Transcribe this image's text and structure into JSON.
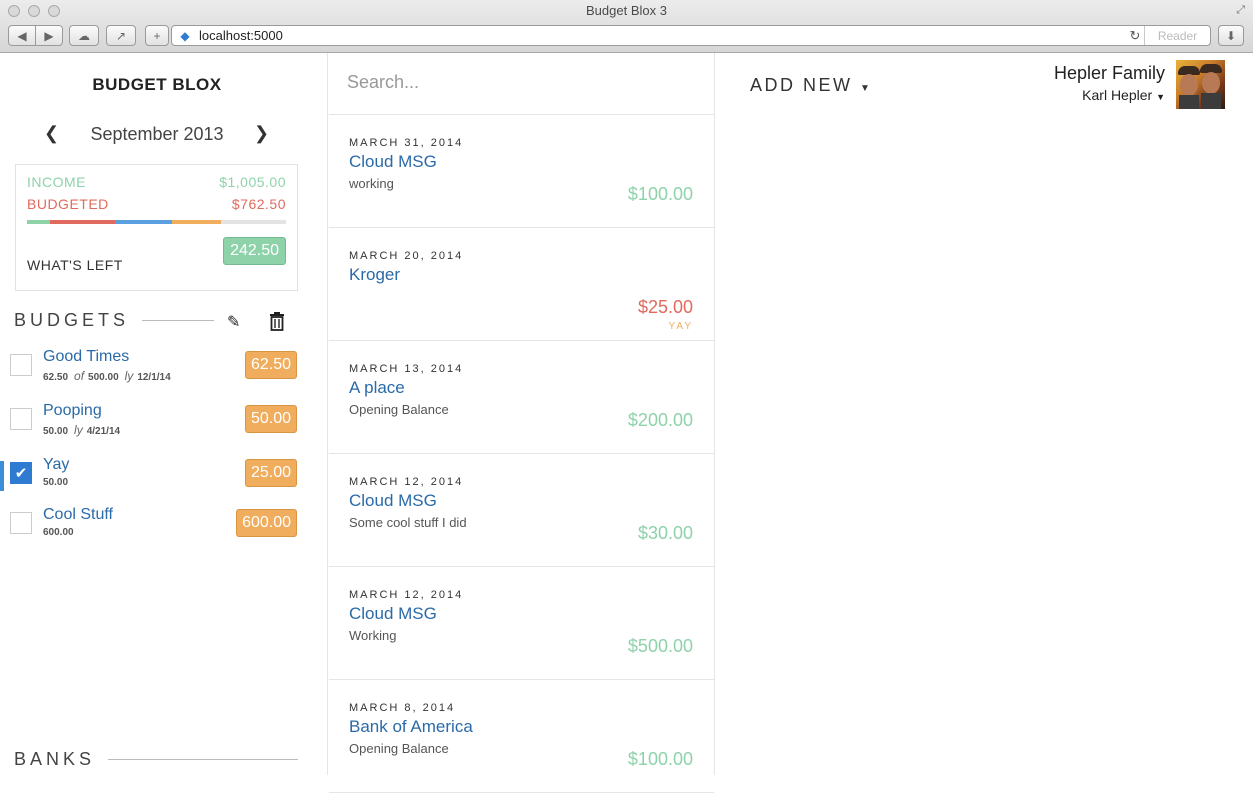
{
  "browser": {
    "window_title": "Budget Blox 3",
    "url": "localhost:5000",
    "reader_label": "Reader"
  },
  "sidebar": {
    "brand": "BUDGET BLOX",
    "month": "September 2013",
    "summary": {
      "income_label": "INCOME",
      "income_value": "$1,005.00",
      "budgeted_label": "BUDGETED",
      "budgeted_value": "$762.50",
      "whats_left_label": "WHAT'S LEFT",
      "whats_left_value": "242.50",
      "progress_segments": [
        {
          "color": "#8ed2aa",
          "fraction": 0.09
        },
        {
          "color": "#e06a5e",
          "fraction": 0.25
        },
        {
          "color": "#5aa0e0",
          "fraction": 0.22
        },
        {
          "color": "#f0ad5d",
          "fraction": 0.19
        },
        {
          "color": "#e3e3e3",
          "fraction": 0.25
        }
      ]
    },
    "budgets_heading": "BUDGETS",
    "budgets": [
      {
        "name": "Good Times",
        "amount": "62.50",
        "of_symbol": "of",
        "of_value": "500.00",
        "due_symbol": "ly",
        "due_date": "12/1/14",
        "badge": "62.50",
        "checked": false
      },
      {
        "name": "Pooping",
        "amount": "50.00",
        "due_symbol": "ly",
        "due_date": "4/21/14",
        "badge": "50.00",
        "checked": false
      },
      {
        "name": "Yay",
        "amount": "50.00",
        "badge": "25.00",
        "checked": true
      },
      {
        "name": "Cool Stuff",
        "amount": "600.00",
        "badge": "600.00",
        "checked": false
      }
    ],
    "banks_heading": "BANKS"
  },
  "search": {
    "placeholder": "Search..."
  },
  "transactions": [
    {
      "date": "MARCH 31, 2014",
      "name": "Cloud MSG",
      "note": "working",
      "amount": "$100.00",
      "type": "income",
      "tag": ""
    },
    {
      "date": "MARCH 20, 2014",
      "name": "Kroger",
      "note": "",
      "amount": "$25.00",
      "type": "expense",
      "tag": "YAY"
    },
    {
      "date": "MARCH 13, 2014",
      "name": "A place",
      "note": "Opening Balance",
      "amount": "$200.00",
      "type": "income",
      "tag": ""
    },
    {
      "date": "MARCH 12, 2014",
      "name": "Cloud MSG",
      "note": "Some cool stuff I did",
      "amount": "$30.00",
      "type": "income",
      "tag": ""
    },
    {
      "date": "MARCH 12, 2014",
      "name": "Cloud MSG",
      "note": "Working",
      "amount": "$500.00",
      "type": "income",
      "tag": ""
    },
    {
      "date": "MARCH 8, 2014",
      "name": "Bank of America",
      "note": "Opening Balance",
      "amount": "$100.00",
      "type": "income",
      "tag": ""
    }
  ],
  "header": {
    "add_new_label": "ADD NEW",
    "family_name": "Hepler Family",
    "user_name": "Karl Hepler"
  },
  "colors": {
    "income": "#8ed2aa",
    "expense": "#e06a5e",
    "budget_badge": "#f0ad5d",
    "link": "#2a6aa8"
  }
}
